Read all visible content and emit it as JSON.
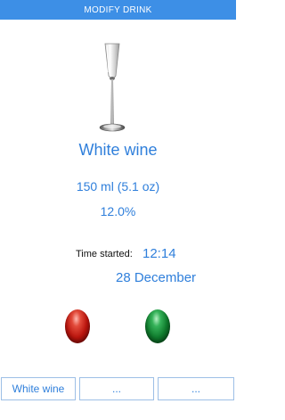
{
  "header": {
    "title": "MODIFY DRINK"
  },
  "drink": {
    "icon": "wine-flute-glass-icon",
    "name": "White wine",
    "volume": "150 ml (5.1 oz)",
    "abv": "12.0%"
  },
  "time": {
    "label": "Time started:",
    "value": "12:14",
    "date": "28 December"
  },
  "actions": {
    "cancel_icon": "red-orb-icon",
    "confirm_icon": "green-orb-icon",
    "cancel_color": "#b9140d",
    "confirm_color": "#0f7a2c"
  },
  "presets": [
    {
      "label": "White wine"
    },
    {
      "label": "..."
    },
    {
      "label": "..."
    }
  ],
  "colors": {
    "header_bg": "#3d8fe6",
    "accent_text": "#2f7fdb"
  }
}
